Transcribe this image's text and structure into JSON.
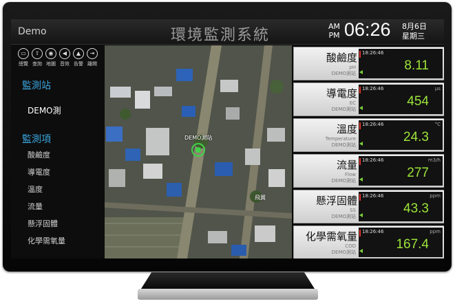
{
  "header": {
    "app_name": "Demo",
    "title": "環境監測系統",
    "am": "AM",
    "pm": "PM",
    "time": "06:26",
    "date": "8月6日",
    "weekday": "星期三"
  },
  "toolbar": [
    {
      "icon": "monitor-icon",
      "label": "總覽"
    },
    {
      "icon": "upload-icon",
      "label": "查詢"
    },
    {
      "icon": "map-pin-icon",
      "label": "地圖"
    },
    {
      "icon": "speaker-icon",
      "label": "音效"
    },
    {
      "icon": "alert-icon",
      "label": "告警"
    },
    {
      "icon": "exit-icon",
      "label": "離開"
    }
  ],
  "sidebar": {
    "stations_heading": "監測站",
    "station": "DEMO測",
    "items_heading": "監測項",
    "items": [
      "酸鹼度",
      "導電度",
      "溫度",
      "流量",
      "懸浮固體",
      "化學需氧量"
    ]
  },
  "map": {
    "marker_label": "DEMO測站",
    "place_label": "飛翼"
  },
  "readings": [
    {
      "name": "酸鹼度",
      "sub": "pH",
      "station": "DEMO測站",
      "time": "18:26:46",
      "unit": "",
      "value": "8.11"
    },
    {
      "name": "導電度",
      "sub": "EC",
      "station": "DEMO測站",
      "time": "18:26:46",
      "unit": "μs",
      "value": "454"
    },
    {
      "name": "溫度",
      "sub": "Temperature",
      "station": "DEMO測站",
      "time": "18:26:46",
      "unit": "°C",
      "value": "24.3"
    },
    {
      "name": "流量",
      "sub": "Flow",
      "station": "DEMO測站",
      "time": "18:26:46",
      "unit": "m3/h",
      "value": "277"
    },
    {
      "name": "懸浮固體",
      "sub": "SS",
      "station": "DEMO測站",
      "time": "18:26:46",
      "unit": "ppm",
      "value": "43.3"
    },
    {
      "name": "化學需氧量",
      "sub": "COD",
      "station": "DEMO測站",
      "time": "18:26:46",
      "unit": "ppm",
      "value": "167.4"
    }
  ],
  "colors": {
    "accent": "#3aa6e0",
    "value": "#9de53b",
    "alert": "#e0302a"
  }
}
